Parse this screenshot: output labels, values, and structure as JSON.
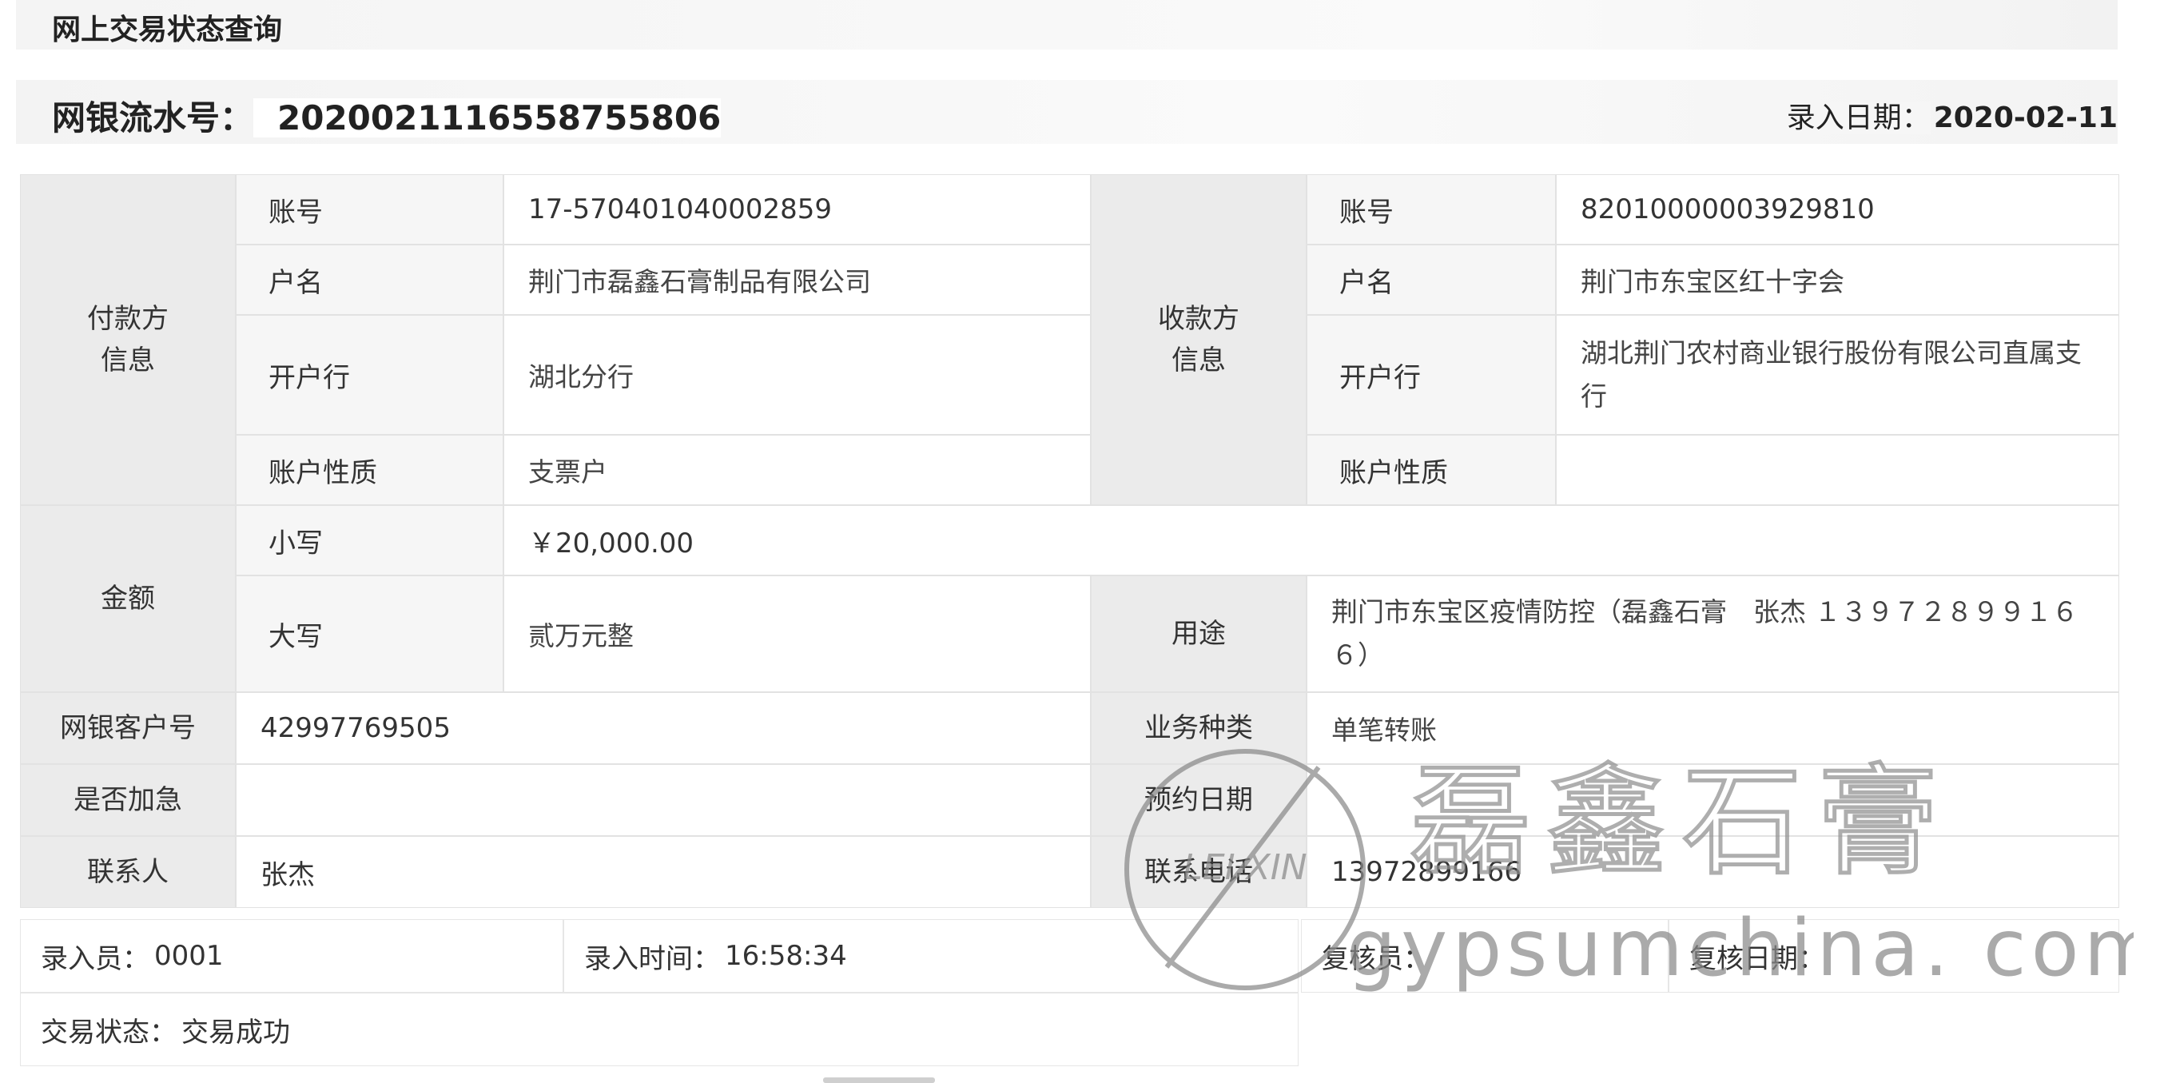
{
  "header": {
    "title": "网上交易状态查询"
  },
  "serial": {
    "label": "网银流水号：",
    "value": "2020021116558755806"
  },
  "entry_date": {
    "label": "录入日期：",
    "value": "2020-02-11"
  },
  "payer": {
    "section_label": "付款方\n信息",
    "account_label": "账号",
    "account": "17-570401040002859",
    "name_label": "户名",
    "name": "荆门市磊鑫石膏制品有限公司",
    "bank_label": "开户行",
    "bank": "湖北分行",
    "type_label": "账户性质",
    "type": "支票户"
  },
  "payee": {
    "section_label": "收款方\n信息",
    "account_label": "账号",
    "account": "82010000003929810",
    "name_label": "户名",
    "name": "荆门市东宝区红十字会",
    "bank_label": "开户行",
    "bank": "湖北荆门农村商业银行股份有限公司直属支行",
    "type_label": "账户性质",
    "type": ""
  },
  "amount": {
    "section_label": "金额",
    "lower_label": "小写",
    "lower": "￥20,000.00",
    "upper_label": "大写",
    "upper": "贰万元整"
  },
  "purpose": {
    "label": "用途",
    "value": "荆门市东宝区疫情防控（磊鑫石膏　张杰 １３９７２８９９１６６）"
  },
  "client_no": {
    "label": "网银客户号",
    "value": "42997769505"
  },
  "business_type": {
    "label": "业务种类",
    "value": "单笔转账"
  },
  "urgent": {
    "label": "是否加急",
    "value": ""
  },
  "appointment_date": {
    "label": "预约日期",
    "value": ""
  },
  "contact": {
    "label": "联系人",
    "value": "张杰"
  },
  "phone": {
    "label": "联系电话",
    "value": "13972899166"
  },
  "footer": {
    "clerk_label": "录入员：",
    "clerk": "0001",
    "entry_time_label": "录入时间：",
    "entry_time": "16:58:34",
    "reviewer_label": "复核员：",
    "reviewer": "",
    "review_date_label": "复核日期：",
    "review_date": "",
    "status_label": "交易状态：",
    "status": "交易成功"
  },
  "watermark": {
    "brand": "磊鑫石膏",
    "site": "gypsumchina. com",
    "seal_text": "LEI XIN"
  }
}
